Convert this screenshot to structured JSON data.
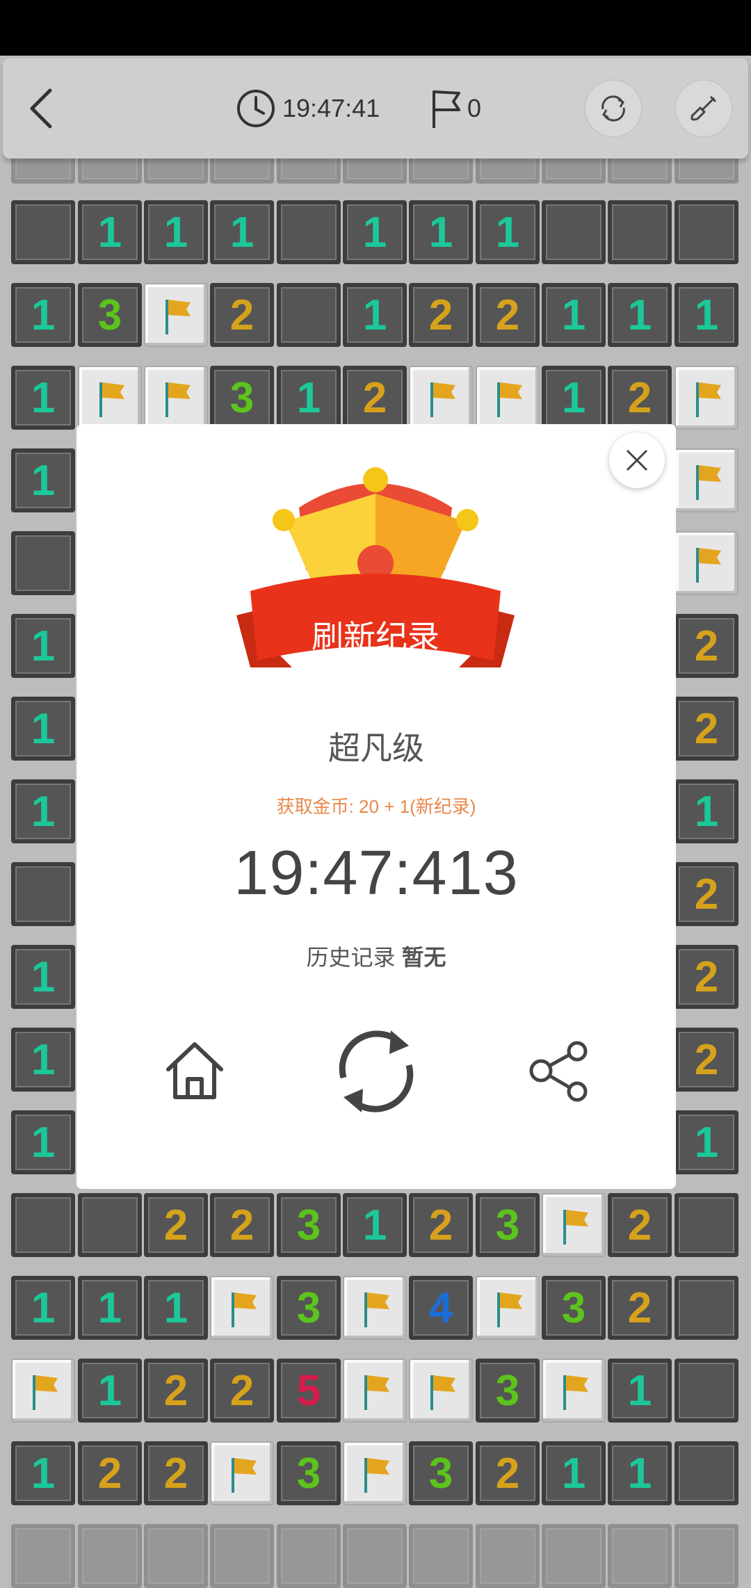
{
  "header": {
    "timer": "19:47:41",
    "flags": "0"
  },
  "dialog": {
    "banner": "刷新纪录",
    "level": "超凡级",
    "coins": "获取金币: 20 + 1(新纪录)",
    "time": "19:47:413",
    "history_label": "历史记录",
    "history_value": "暂无"
  },
  "colors": {
    "n1": "#1cc89a",
    "n2": "#d6a21c",
    "n3": "#5cc41c",
    "n4": "#1a6ed8",
    "n5": "#d61c4a"
  },
  "board": {
    "rows": [
      [
        "e",
        "1",
        "1",
        "1",
        "e",
        "1",
        "1",
        "1",
        "e",
        "e",
        "e"
      ],
      [
        "1",
        "3",
        "F",
        "2",
        "e",
        "1",
        "2",
        "2",
        "1",
        "1",
        "1"
      ],
      [
        "1",
        "F",
        "F",
        "3",
        "1",
        "2",
        "F",
        "F",
        "1",
        "2",
        "F"
      ],
      [
        "1",
        "",
        "",
        "",
        "",
        "",
        "",
        "",
        "",
        "",
        "F"
      ],
      [
        "e",
        "",
        "",
        "",
        "",
        "",
        "",
        "",
        "",
        "",
        "F"
      ],
      [
        "1",
        "",
        "",
        "",
        "",
        "",
        "",
        "",
        "",
        "",
        "2"
      ],
      [
        "1",
        "",
        "",
        "",
        "",
        "",
        "",
        "",
        "",
        "",
        "2"
      ],
      [
        "1",
        "",
        "",
        "",
        "",
        "",
        "",
        "",
        "",
        "",
        "1"
      ],
      [
        "e",
        "",
        "",
        "",
        "",
        "",
        "",
        "",
        "",
        "",
        "2"
      ],
      [
        "1",
        "",
        "",
        "",
        "",
        "",
        "",
        "",
        "",
        "",
        "2"
      ],
      [
        "1",
        "",
        "",
        "",
        "",
        "",
        "",
        "",
        "",
        "",
        "2"
      ],
      [
        "1",
        "",
        "",
        "",
        "",
        "",
        "",
        "",
        "",
        "",
        "1"
      ],
      [
        "e",
        "e",
        "2",
        "2",
        "3",
        "1",
        "2",
        "3",
        "F",
        "2",
        "e"
      ],
      [
        "1",
        "1",
        "1",
        "F",
        "3",
        "F",
        "4",
        "F",
        "3",
        "2",
        "e"
      ],
      [
        "F",
        "1",
        "2",
        "2",
        "5",
        "F",
        "F",
        "3",
        "F",
        "1",
        "e"
      ],
      [
        "1",
        "2",
        "2",
        "F",
        "3",
        "F",
        "3",
        "2",
        "1",
        "1",
        "e"
      ]
    ]
  }
}
